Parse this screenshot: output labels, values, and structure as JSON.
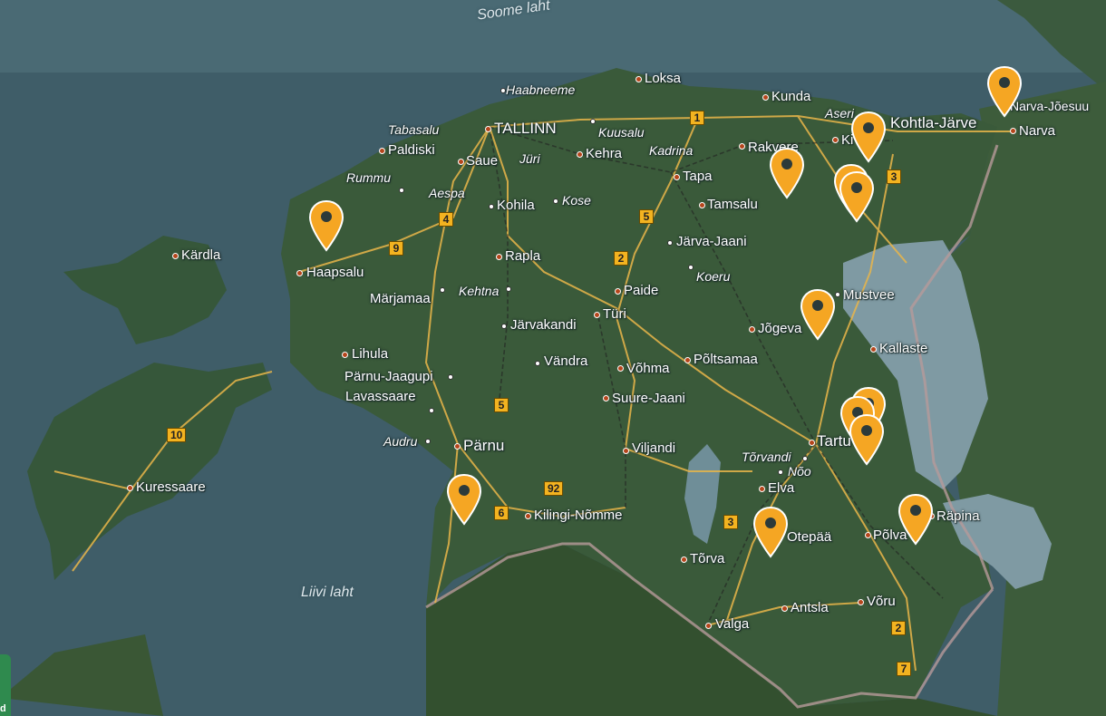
{
  "water_labels": {
    "soome_laht": "Soome laht",
    "liivi_laht": "Liivi laht"
  },
  "cities": {
    "tallinn": "TALLINN",
    "loksa": "Loksa",
    "haabneeme": "Haabneeme",
    "kunda": "Kunda",
    "aseri": "Aseri",
    "kohtla_jarve": "Kohtla-Järve",
    "narva_joesuu": "Narva-Jõesuu",
    "narva": "Narva",
    "tabasalu": "Tabasalu",
    "kuusalu": "Kuusalu",
    "paldiski": "Paldiski",
    "saue": "Saue",
    "juri": "Jüri",
    "kehra": "Kehra",
    "kadrina": "Kadrina",
    "rakvere": "Rakvere",
    "kiviõli": "Ki",
    "rummu": "Rummu",
    "aespa": "Aespa",
    "kohila": "Kohila",
    "kose": "Kose",
    "tapa": "Tapa",
    "tamsalu": "Tamsalu",
    "jarva_jaani": "Järva-Jaani",
    "kardla": "Kärdla",
    "haapsalu": "Haapsalu",
    "rapla": "Rapla",
    "koeru": "Koeru",
    "paide": "Paide",
    "marjamaa": "Märjamaa",
    "kehtna": "Kehtna",
    "mustvee": "Mustvee",
    "jarvakandi": "Järvakandi",
    "turi": "Türi",
    "jogeva": "Jõgeva",
    "lihula": "Lihula",
    "kallaste": "Kallaste",
    "pamu_jaagupi": "Pärnu-Jaagupi",
    "vandra": "Vändra",
    "vohma": "Võhma",
    "poltsamaa": "Põltsamaa",
    "lavassaare": "Lavassaare",
    "suure_jaani": "Suure-Jaani",
    "audru": "Audru",
    "parnu": "Pärnu",
    "viljandi": "Viljandi",
    "tartu": "Tartu",
    "torvandi": "Tõrvandi",
    "noo": "Nõo",
    "kuressaare": "Kuressaare",
    "elva": "Elva",
    "kilingi_nomme": "Kilingi-Nõmme",
    "rapina": "Räpina",
    "otepaa": "Otepää",
    "polva": "Põlva",
    "torva": "Tõrva",
    "antsla": "Antsla",
    "voru": "Võru",
    "valga": "Valga"
  },
  "road_numbers": {
    "r1": "1",
    "r2a": "2",
    "r2b": "2",
    "r3a": "3",
    "r3b": "3",
    "r4": "4",
    "r5a": "5",
    "r5b": "5",
    "r6": "6",
    "r7": "7",
    "r9": "9",
    "r10": "10",
    "r92": "92"
  },
  "markers": [
    {
      "id": "haapsalu-area",
      "icon": "map-pin-icon"
    },
    {
      "id": "rakvere-area",
      "icon": "map-pin-icon"
    },
    {
      "id": "kohtla-jarve-area",
      "icon": "map-pin-icon"
    },
    {
      "id": "iisaku-area",
      "icon": "map-pin-icon"
    },
    {
      "id": "narva-joesuu-area",
      "icon": "map-pin-icon"
    },
    {
      "id": "mustvee-area",
      "icon": "map-pin-icon"
    },
    {
      "id": "tartu-area",
      "icon": "map-pin-icon"
    },
    {
      "id": "parnu-area",
      "icon": "map-pin-icon"
    },
    {
      "id": "otepaa-area",
      "icon": "map-pin-icon"
    },
    {
      "id": "polva-area",
      "icon": "map-pin-icon"
    }
  ],
  "corner_badge": "d",
  "colors": {
    "marker": "#f5a623",
    "road": "#e9b64a",
    "border": "#b79a9a",
    "water": "#3d5a66",
    "land": "#3a5a3c"
  }
}
